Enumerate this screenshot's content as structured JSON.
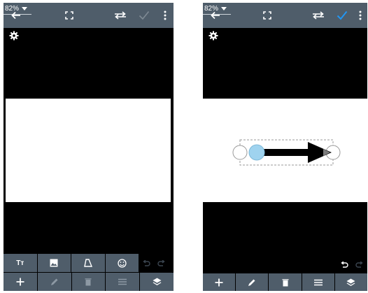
{
  "screens": [
    {
      "zoom": "82%",
      "text_tool_label": "Tт",
      "has_selection": false
    },
    {
      "zoom": "82%",
      "has_selection": true
    }
  ],
  "colors": {
    "appbar": "#4f5d6a",
    "canvas_background": "#000000",
    "canvas": "#ffffff",
    "accent": "#2196f3",
    "handle_fill": "#9fd3ef",
    "arrow": "#000000"
  },
  "icons": {
    "back": "arrow-left",
    "fullscreen": "fullscreen-brackets",
    "swap": "swap-arrows",
    "confirm": "checkmark",
    "more": "vertical-dots",
    "settings": "gear",
    "undo": "undo-arrow",
    "redo": "redo-arrow",
    "text": "text-format",
    "image": "image",
    "shape": "trapezoid",
    "emoji": "smiley",
    "add": "plus",
    "edit": "pencil",
    "delete": "trash",
    "align": "lines",
    "layers": "layers"
  }
}
